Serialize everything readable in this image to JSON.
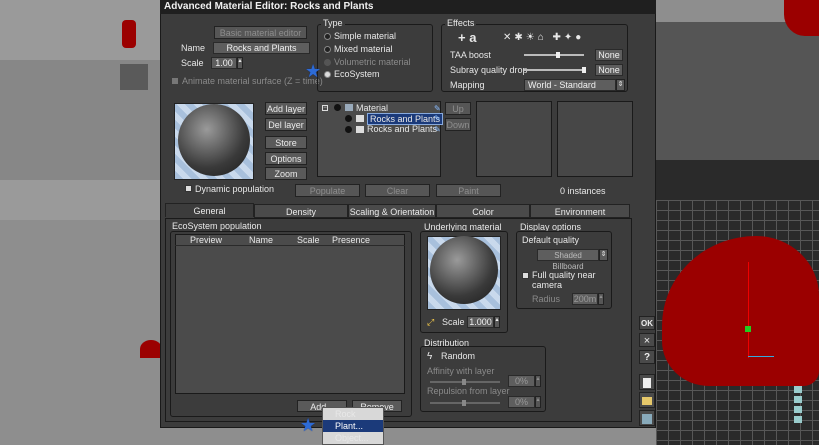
{
  "window": {
    "title": "Advanced Material Editor: Rocks and Plants"
  },
  "basic": {
    "basic_editor_button": "Basic material editor",
    "name_label": "Name",
    "name_value": "Rocks and Plants",
    "scale_label": "Scale",
    "scale_value": "1.00",
    "animate_label": "Animate material surface (Z = time)"
  },
  "type": {
    "title": "Type",
    "options": [
      "Simple material",
      "Mixed material",
      "Volumetric material",
      "EcoSystem"
    ],
    "selected": "EcoSystem"
  },
  "effects": {
    "title": "Effects",
    "taa_label": "TAA boost",
    "taa_value": "None",
    "subray_label": "Subray quality drop",
    "subray_value": "None",
    "mapping_label": "Mapping",
    "mapping_value": "World - Standard"
  },
  "layers": {
    "add": "Add layer",
    "del": "Del layer",
    "store": "Store",
    "options": "Options",
    "zoom": "Zoom",
    "dynamic_population": "Dynamic population",
    "tree": [
      "Material",
      "Rocks and Plants",
      "Rocks and Plants"
    ],
    "up": "Up",
    "down": "Down"
  },
  "actions": {
    "populate": "Populate",
    "clear": "Clear",
    "paint": "Paint",
    "instances": "0 instances"
  },
  "tabs": [
    "General",
    "Density",
    "Scaling & Orientation",
    "Color",
    "Environment"
  ],
  "population": {
    "title": "EcoSystem population",
    "columns": [
      "Preview",
      "Name",
      "Scale",
      "Presence"
    ],
    "add": "Add...",
    "remove": "Remove"
  },
  "underlying": {
    "title": "Underlying material",
    "scale_label": "Scale",
    "scale_value": "1.000"
  },
  "display": {
    "title": "Display options",
    "default_quality": "Default quality",
    "quality_value": "Shaded Billboard",
    "full_quality": "Full quality near camera",
    "radius_label": "Radius",
    "radius_value": "200m"
  },
  "distribution": {
    "title": "Distribution",
    "mode": "Random",
    "affinity_label": "Affinity with layer",
    "affinity_value": "0%",
    "repulsion_label": "Repulsion from layer",
    "repulsion_value": "0%"
  },
  "side": {
    "ok": "OK",
    "close": "×",
    "help": "?"
  },
  "menu": {
    "items": [
      "Rock",
      "Plant...",
      "Object..."
    ],
    "selected": "Plant..."
  },
  "colors": {
    "accent": "#1b3a7a",
    "red": "#9b0000"
  }
}
